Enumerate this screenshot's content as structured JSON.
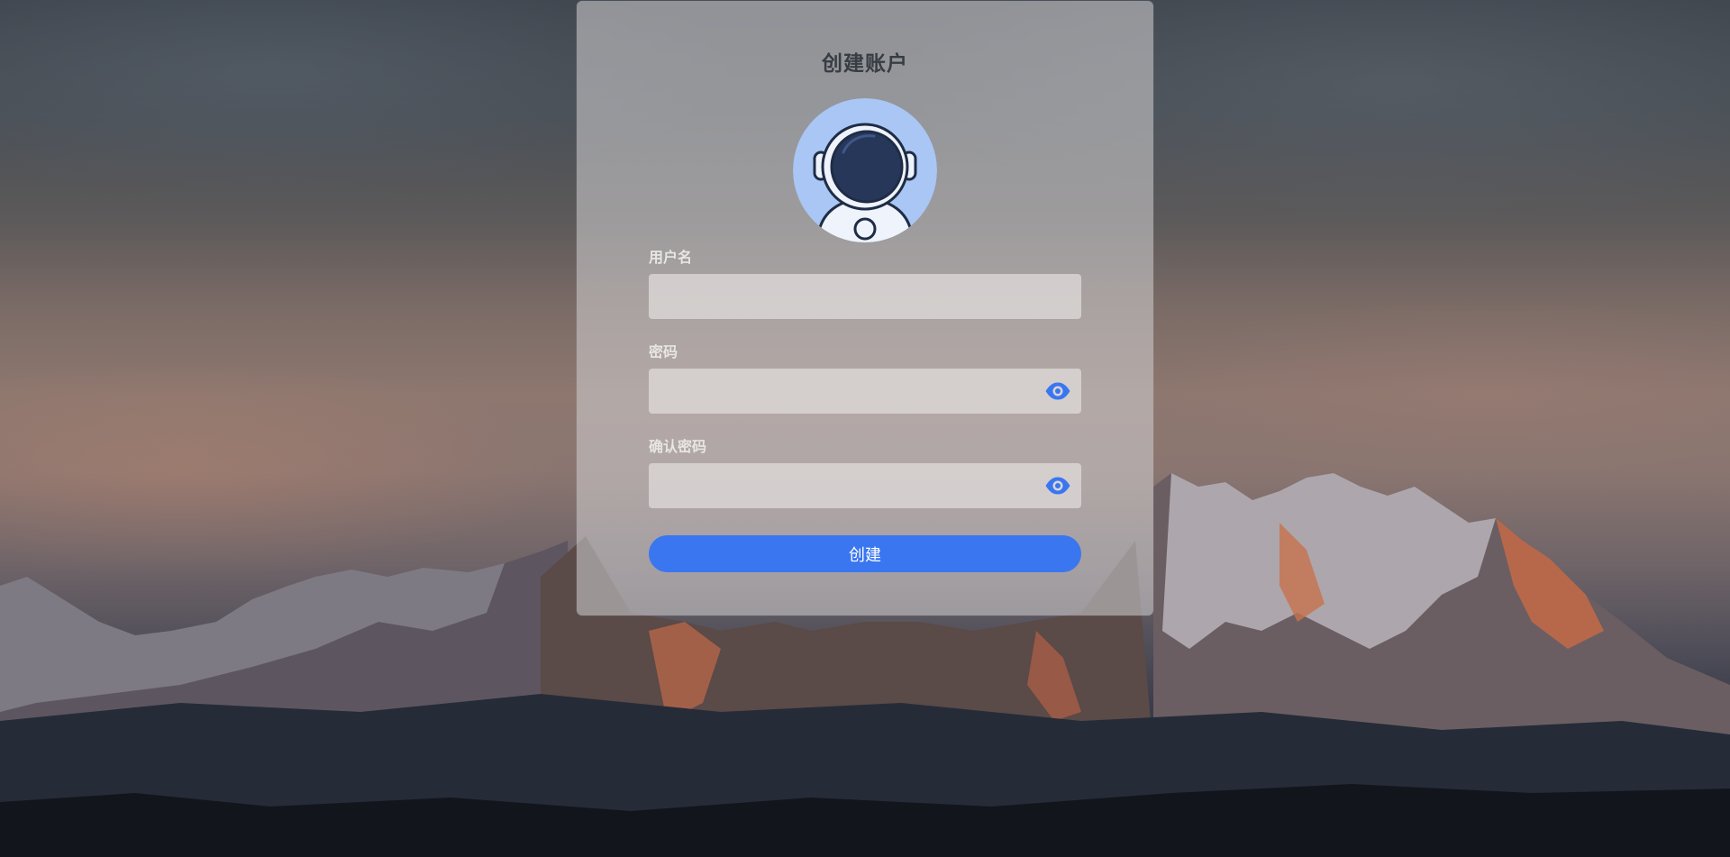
{
  "form": {
    "title": "创建账户",
    "username": {
      "label": "用户名",
      "value": "",
      "placeholder": ""
    },
    "password": {
      "label": "密码",
      "value": "",
      "placeholder": ""
    },
    "confirm_password": {
      "label": "确认密码",
      "value": "",
      "placeholder": ""
    },
    "submit_label": "创建"
  },
  "icons": {
    "avatar": "astronaut-avatar-icon",
    "toggle_password": "eye-icon",
    "toggle_confirm_password": "eye-icon"
  },
  "colors": {
    "accent": "#3a76f0",
    "avatar_background": "#a9c6f5",
    "title": "#383d44",
    "label": "#e8e5e5"
  }
}
